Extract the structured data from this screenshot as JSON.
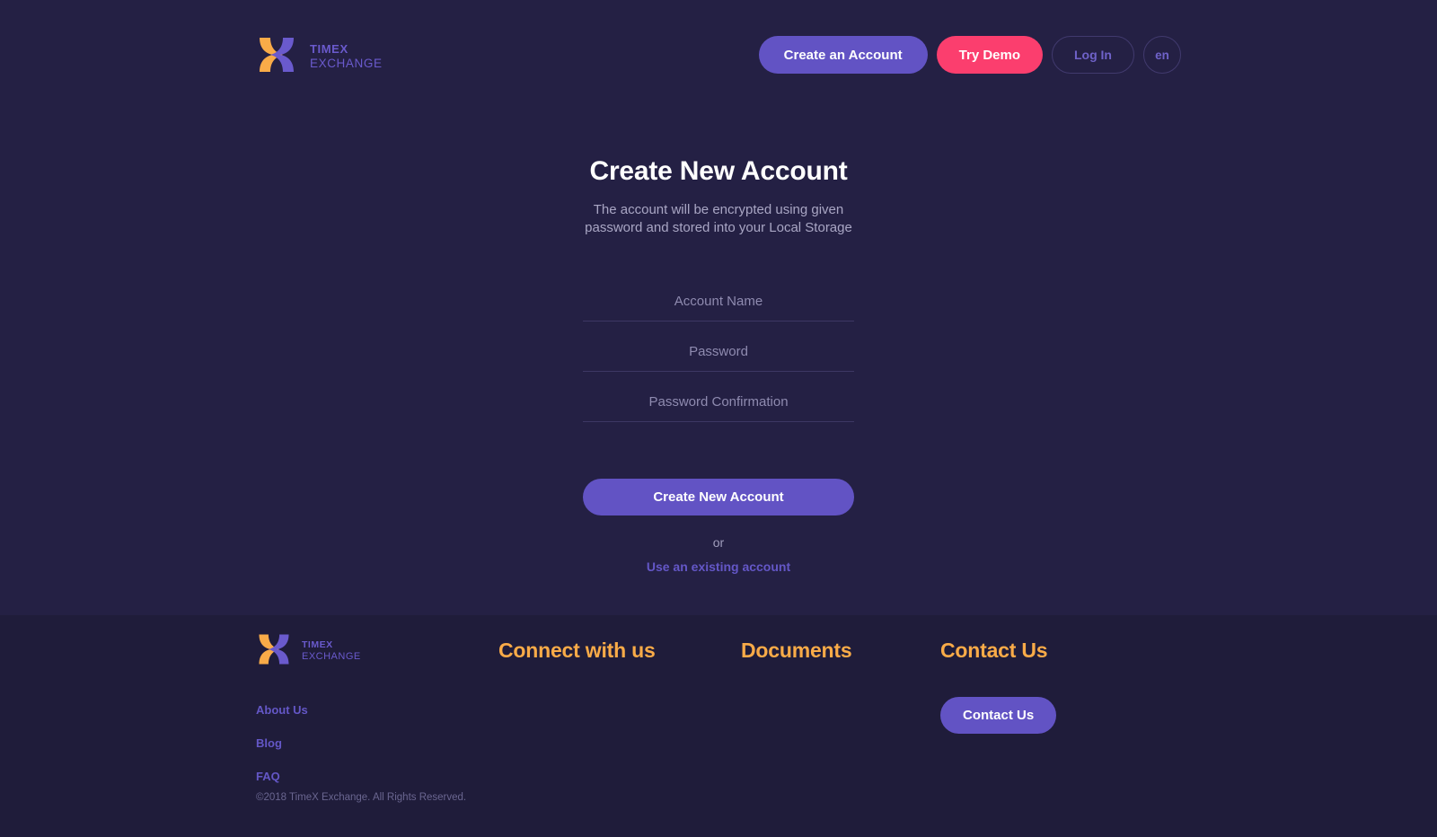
{
  "brand": {
    "logo_icon": "timex-x-logo-icon",
    "name_top": "TIMEX",
    "name_bottom": "EXCHANGE",
    "colors": {
      "orange": "#f9ab48",
      "purple": "#6a5acd"
    }
  },
  "header": {
    "actions": {
      "create_account": "Create an Account",
      "try_demo": "Try Demo",
      "log_in": "Log In",
      "language": "en"
    }
  },
  "main": {
    "title": "Create New Account",
    "subtitle": "The account will be encrypted using given password and stored into your Local Storage",
    "fields": [
      {
        "name": "account-name",
        "placeholder": "Account Name",
        "value": "",
        "type": "text"
      },
      {
        "name": "password",
        "placeholder": "Password",
        "value": "",
        "type": "password"
      },
      {
        "name": "password-confirmation",
        "placeholder": "Password Confirmation",
        "value": "",
        "type": "password"
      }
    ],
    "submit_label": "Create New Account",
    "or_label": "or",
    "existing_account_label": "Use an existing account"
  },
  "footer": {
    "headings": {
      "connect": "Connect with us",
      "documents": "Documents",
      "contact": "Contact Us"
    },
    "links": [
      {
        "label": "About Us"
      },
      {
        "label": "Blog"
      },
      {
        "label": "FAQ"
      }
    ],
    "contact_button": "Contact Us",
    "copyright": "©2018 TimeX Exchange. All Rights Reserved."
  },
  "theme": {
    "background": "#242044",
    "footer_background": "#1f1c3a",
    "accent_purple": "#6253c4",
    "accent_pink": "#fb3e6e",
    "accent_orange": "#f9ab48",
    "link_purple": "#6457c7"
  }
}
